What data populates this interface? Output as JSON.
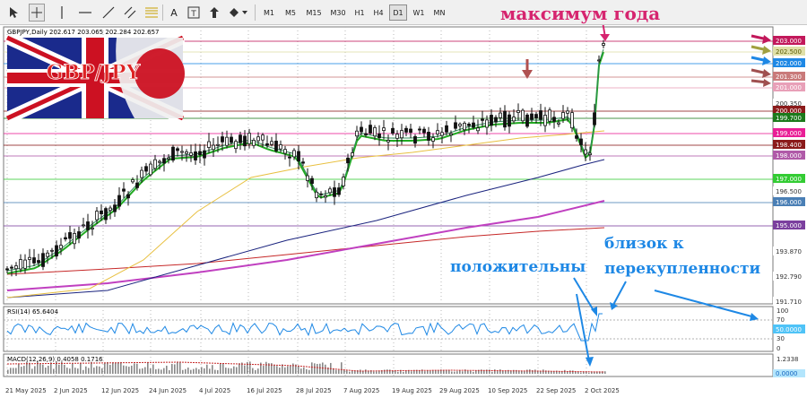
{
  "toolbar": {
    "timeframes": [
      "M1",
      "M5",
      "M15",
      "M30",
      "H1",
      "H4",
      "D1",
      "W1",
      "MN"
    ],
    "active_timeframe": "D1"
  },
  "chart": {
    "info": "GBPJPY,Daily  202.617 203.065 202.284 202.657",
    "logo_text": "GBP/JPY",
    "price_axis": [
      {
        "label": "203.000",
        "bg": "#c2185b",
        "fg": "#ffffff"
      },
      {
        "label": "202.500",
        "bg": "#e0e0a8",
        "fg": "#5a5a00"
      },
      {
        "label": "202.000",
        "bg": "#1e88e5",
        "fg": "#ffffff"
      },
      {
        "label": "201.300",
        "bg": "#c97a7a",
        "fg": "#ffffff"
      },
      {
        "label": "201.000",
        "bg": "#e8a0b8",
        "fg": "#ffffff"
      },
      {
        "label": "200.350",
        "bg": "#ffffff",
        "fg": "#333333"
      },
      {
        "label": "200.000",
        "bg": "#8b1a1a",
        "fg": "#ffffff"
      },
      {
        "label": "199.700",
        "bg": "#1b7a1b",
        "fg": "#ffffff"
      },
      {
        "label": "199.000",
        "bg": "#e91e96",
        "fg": "#ffffff"
      },
      {
        "label": "198.400",
        "bg": "#8b1a1a",
        "fg": "#ffffff"
      },
      {
        "label": "198.000",
        "bg": "#b05aa8",
        "fg": "#ffffff"
      },
      {
        "label": "197.000",
        "bg": "#33cc33",
        "fg": "#ffffff"
      },
      {
        "label": "196.500",
        "bg": "#ffffff",
        "fg": "#333333"
      },
      {
        "label": "196.000",
        "bg": "#4a7fb5",
        "fg": "#ffffff"
      },
      {
        "label": "195.000",
        "bg": "#7b3f9e",
        "fg": "#ffffff"
      },
      {
        "label": "193.870",
        "bg": "#ffffff",
        "fg": "#333333"
      },
      {
        "label": "192.790",
        "bg": "#ffffff",
        "fg": "#333333"
      },
      {
        "label": "191.710",
        "bg": "#ffffff",
        "fg": "#333333"
      }
    ],
    "date_axis": [
      "21 May 2025",
      "2 Jun 2025",
      "12 Jun 2025",
      "24 Jun 2025",
      "4 Jul 2025",
      "16 Jul 2025",
      "28 Jul 2025",
      "7 Aug 2025",
      "19 Aug 2025",
      "29 Aug 2025",
      "10 Sep 2025",
      "22 Sep 2025",
      "2 Oct 2025"
    ]
  },
  "rsi": {
    "label": "RSI(14) 65.6404",
    "axis": [
      "100",
      "70",
      "30",
      "0"
    ],
    "level_label": "50.0000"
  },
  "macd": {
    "label": "MACD(12,26,9) 0.4058 0.1716",
    "axis": [
      "1.2338"
    ],
    "zero_label": "0.0000"
  },
  "annotations": {
    "year_high": "максимум года",
    "positive": "положительны",
    "near_1": "близок к",
    "near_2": "перекупленности"
  },
  "colors": {
    "candle": "#111111",
    "ma_fast": "#2e8b57",
    "ma_green": "#22aa22",
    "ma_yellow": "#e8c040",
    "ma_navy": "#1a237e",
    "ma_purple": "#c040c0",
    "ma_red": "#c62828",
    "annotation_pink": "#d6246f",
    "annotation_blue": "#1e88e5"
  }
}
